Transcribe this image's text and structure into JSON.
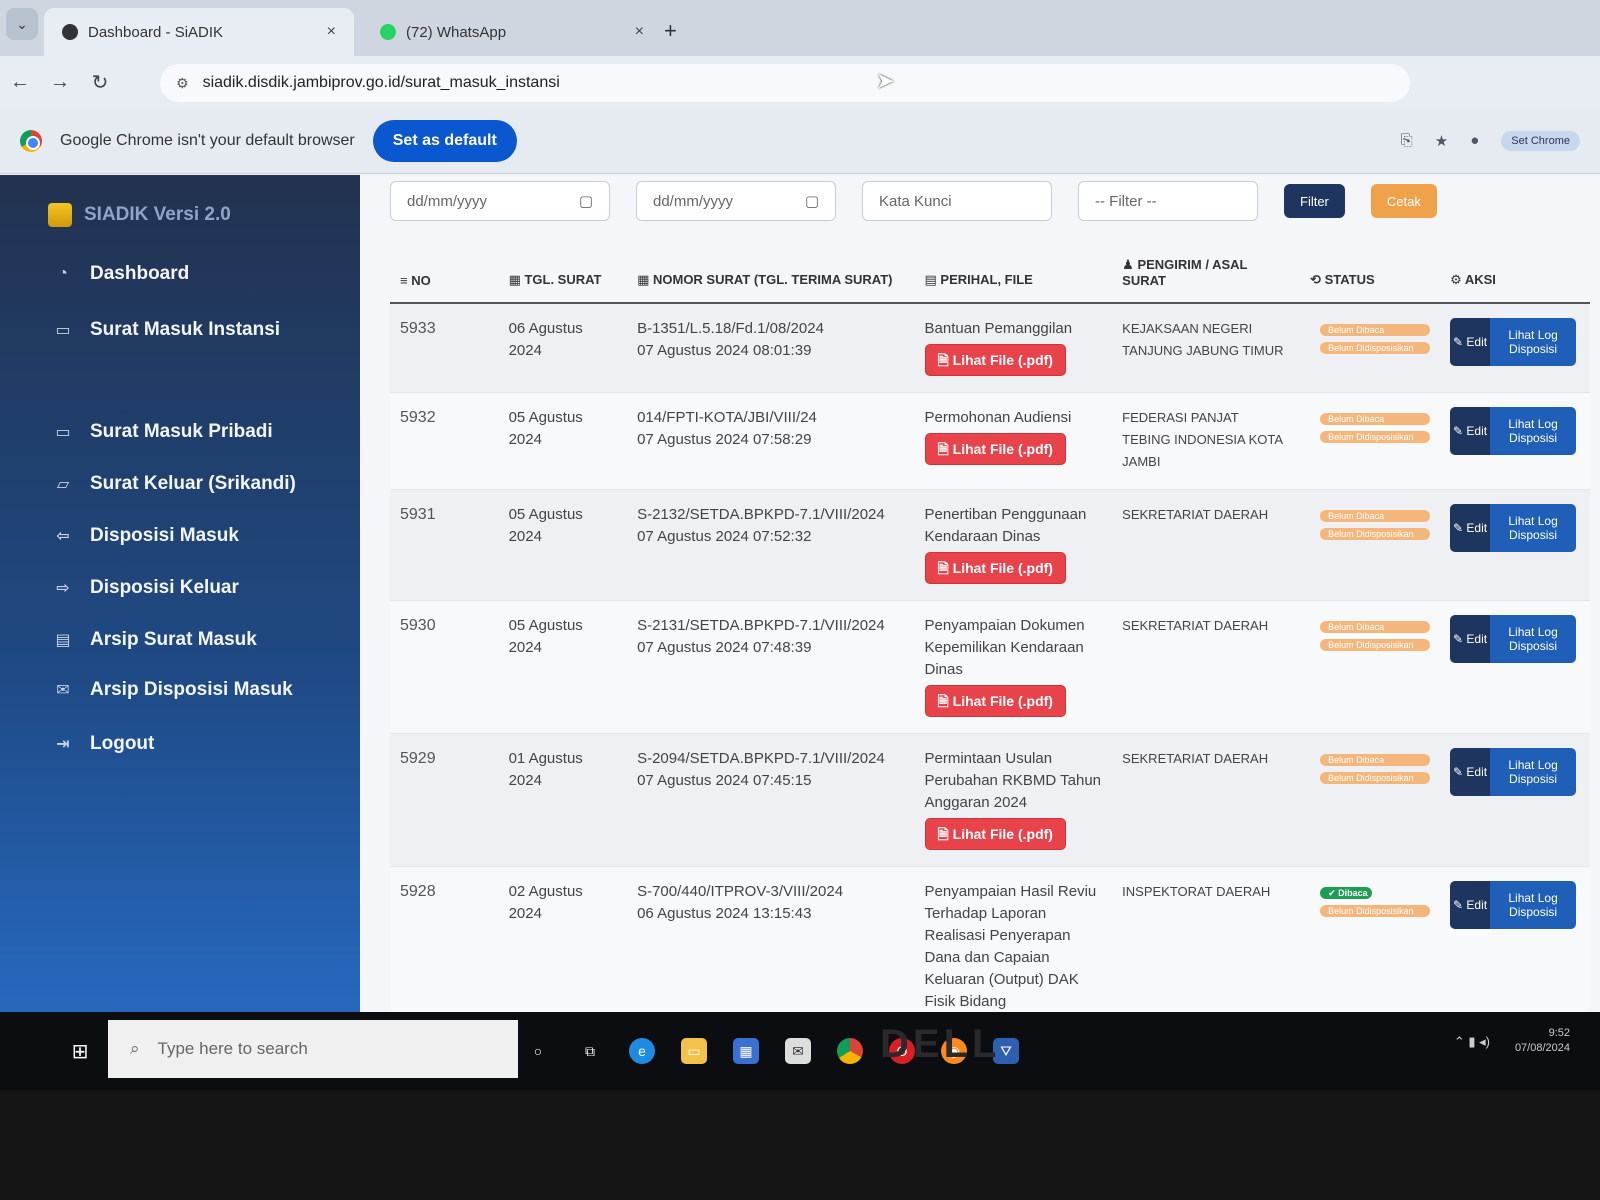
{
  "browser": {
    "tabs": [
      {
        "title": "Dashboard - SiADIK",
        "close": "×"
      },
      {
        "title": "(72) WhatsApp",
        "close": "×"
      }
    ],
    "new_tab": "+",
    "url": "siadik.disdik.jambiprov.go.id/surat_masuk_instansi",
    "infobar_message": "Google Chrome isn't your default browser",
    "set_default_label": "Set as default",
    "profile_label": "Set Chrome"
  },
  "sidebar": {
    "brand": "SIADIK Versi 2.0",
    "items": [
      {
        "label": "Dashboard",
        "icon": "dashboard-icon",
        "glyph": "◔"
      },
      {
        "label": "Surat Masuk Instansi",
        "icon": "inbox-icon",
        "glyph": "▭"
      },
      {
        "label": "Surat Masuk Pribadi",
        "icon": "inbox-icon",
        "glyph": "▭"
      },
      {
        "label": "Surat Keluar (Srikandi)",
        "icon": "folder-icon",
        "glyph": "▱"
      },
      {
        "label": "Disposisi Masuk",
        "icon": "share-icon",
        "glyph": "⇦"
      },
      {
        "label": "Disposisi Keluar",
        "icon": "share-icon",
        "glyph": "⇨"
      },
      {
        "label": "Arsip Surat Masuk",
        "icon": "archive-icon",
        "glyph": "▤"
      },
      {
        "label": "Arsip Disposisi Masuk",
        "icon": "envelope-icon",
        "glyph": "✉"
      },
      {
        "label": "Logout",
        "icon": "logout-icon",
        "glyph": "⇥"
      }
    ]
  },
  "filters": {
    "date_from_placeholder": "dd/mm/yyyy",
    "date_to_placeholder": "dd/mm/yyyy",
    "keyword_placeholder": "Kata Kunci",
    "select_value": "-- Filter --",
    "filter_label": "Filter",
    "print_label": "Cetak"
  },
  "table": {
    "headers": {
      "no": "≡ NO",
      "tgl": "▦ TGL. SURAT",
      "nomor": "▦ NOMOR SURAT (TGL. TERIMA SURAT)",
      "perihal": "▤ PERIHAL, FILE",
      "pengirim": "♟ PENGIRIM / ASAL SURAT",
      "status": "⟲ STATUS",
      "aksi": "⚙ AKSI"
    },
    "pdf_label": "🗎 Lihat File (.pdf)",
    "edit_label": "✎ Edit",
    "log_label": "Lihat Log Disposisi",
    "rows": [
      {
        "no": "5933",
        "tgl": "06 Agustus 2024",
        "nomor": "B-1351/L.5.18/Fd.1/08/2024",
        "terima": "07 Agustus 2024 08:01:39",
        "perihal": "Bantuan Pemanggilan",
        "pengirim": "KEJAKSAAN NEGERI TANJUNG JABUNG TIMUR",
        "status1": "Belum Dibaca",
        "status2": "Belum Didisposisikan",
        "read": false
      },
      {
        "no": "5932",
        "tgl": "05 Agustus 2024",
        "nomor": "014/FPTI-KOTA/JBI/VIII/24",
        "terima": "07 Agustus 2024 07:58:29",
        "perihal": "Permohonan Audiensi",
        "pengirim": "FEDERASI PANJAT TEBING INDONESIA KOTA JAMBI",
        "status1": "Belum Dibaca",
        "status2": "Belum Didisposisikan",
        "read": false
      },
      {
        "no": "5931",
        "tgl": "05 Agustus 2024",
        "nomor": "S-2132/SETDA.BPKPD-7.1/VIII/2024",
        "terima": "07 Agustus 2024 07:52:32",
        "perihal": "Penertiban Penggunaan Kendaraan Dinas",
        "pengirim": "SEKRETARIAT DAERAH",
        "status1": "Belum Dibaca",
        "status2": "Belum Didisposisikan",
        "read": false
      },
      {
        "no": "5930",
        "tgl": "05 Agustus 2024",
        "nomor": "S-2131/SETDA.BPKPD-7.1/VIII/2024",
        "terima": "07 Agustus 2024 07:48:39",
        "perihal": "Penyampaian Dokumen Kepemilikan Kendaraan Dinas",
        "pengirim": "SEKRETARIAT DAERAH",
        "status1": "Belum Dibaca",
        "status2": "Belum Didisposisikan",
        "read": false
      },
      {
        "no": "5929",
        "tgl": "01 Agustus 2024",
        "nomor": "S-2094/SETDA.BPKPD-7.1/VIII/2024",
        "terima": "07 Agustus 2024 07:45:15",
        "perihal": "Permintaan Usulan Perubahan RKBMD Tahun Anggaran 2024",
        "pengirim": "SEKRETARIAT DAERAH",
        "status1": "Belum Dibaca",
        "status2": "Belum Didisposisikan",
        "read": false
      },
      {
        "no": "5928",
        "tgl": "02 Agustus 2024",
        "nomor": "S-700/440/ITPROV-3/VIII/2024",
        "terima": "06 Agustus 2024 13:15:43",
        "perihal": "Penyampaian Hasil Reviu Terhadap Laporan Realisasi Penyerapan Dana dan Capaian Keluaran (Output) DAK Fisik Bidang",
        "pengirim": "INSPEKTORAT DAERAH",
        "status1": "✔ Dibaca",
        "status2": "Belum Didisposisikan",
        "read": true
      }
    ]
  },
  "taskbar": {
    "search_placeholder": "Type here to search",
    "time": "9:52",
    "date": "07/08/2024"
  },
  "monitor_brand": "DELL",
  "colors": {
    "sidebar_top": "#22324f",
    "sidebar_bottom": "#2769bf",
    "pdf_button": "#e8434a",
    "edit_button": "#1e3560",
    "log_button": "#1f5fb8",
    "set_default": "#0b57d0"
  }
}
